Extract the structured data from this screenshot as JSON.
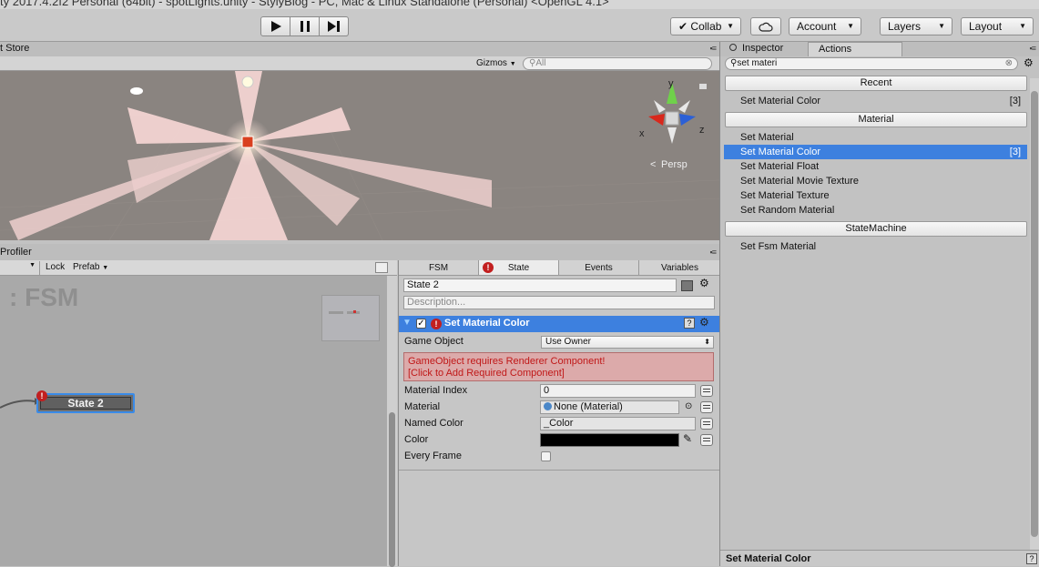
{
  "window": {
    "title": "ty 2017.4.2f2 Personal (64bit) - spotLights.unity - StylyBlog - PC, Mac & Linux Standalone (Personal) <OpenGL 4.1>"
  },
  "toolbar": {
    "collab": "Collab",
    "account": "Account",
    "layers": "Layers",
    "layout": "Layout"
  },
  "scene": {
    "tab_label": "t Store",
    "gizmos": "Gizmos",
    "search_placeholder": "All",
    "persp": "Persp",
    "axis_y": "y",
    "axis_x": "x",
    "axis_z": "z",
    "colors": {
      "sky": "#8a8480",
      "beam": "#f4d8d6"
    }
  },
  "profiler": {
    "tab_label": "Profiler"
  },
  "fsm_toolbar": {
    "lock": "Lock",
    "prefab": "Prefab"
  },
  "fsm": {
    "title": ": FSM",
    "state_node": "State 2"
  },
  "state_panel": {
    "tabs": [
      "FSM",
      "State",
      "Events",
      "Variables"
    ],
    "state_name": "State 2",
    "description_placeholder": "Description...",
    "action_title": "Set Material Color",
    "game_object_label": "Game Object",
    "game_object_value": "Use Owner",
    "error_line1": "GameObject requires Renderer Component!",
    "error_line2": "[Click to Add Required Component]",
    "material_index_label": "Material Index",
    "material_index_value": "0",
    "material_label": "Material",
    "material_value": "None (Material)",
    "named_color_label": "Named Color",
    "named_color_value": "_Color",
    "color_label": "Color",
    "color_value_hex": "#000000",
    "every_frame_label": "Every Frame"
  },
  "right_tabs": {
    "inspector": "Inspector",
    "actions": "Actions"
  },
  "actions": {
    "search_value": "set materi",
    "categories": [
      {
        "label": "Recent",
        "items": [
          {
            "label": "Set Material Color",
            "count": "[3]"
          }
        ]
      },
      {
        "label": "Material",
        "items": [
          {
            "label": "Set Material"
          },
          {
            "label": "Set Material Color",
            "count": "[3]"
          },
          {
            "label": "Set Material Float"
          },
          {
            "label": "Set Material Movie Texture"
          },
          {
            "label": "Set Material Texture"
          },
          {
            "label": "Set Random Material"
          }
        ]
      },
      {
        "label": "StateMachine",
        "items": [
          {
            "label": "Set Fsm Material"
          }
        ]
      }
    ],
    "footer": "Set Material Color",
    "selection_color": "#3d80df"
  }
}
